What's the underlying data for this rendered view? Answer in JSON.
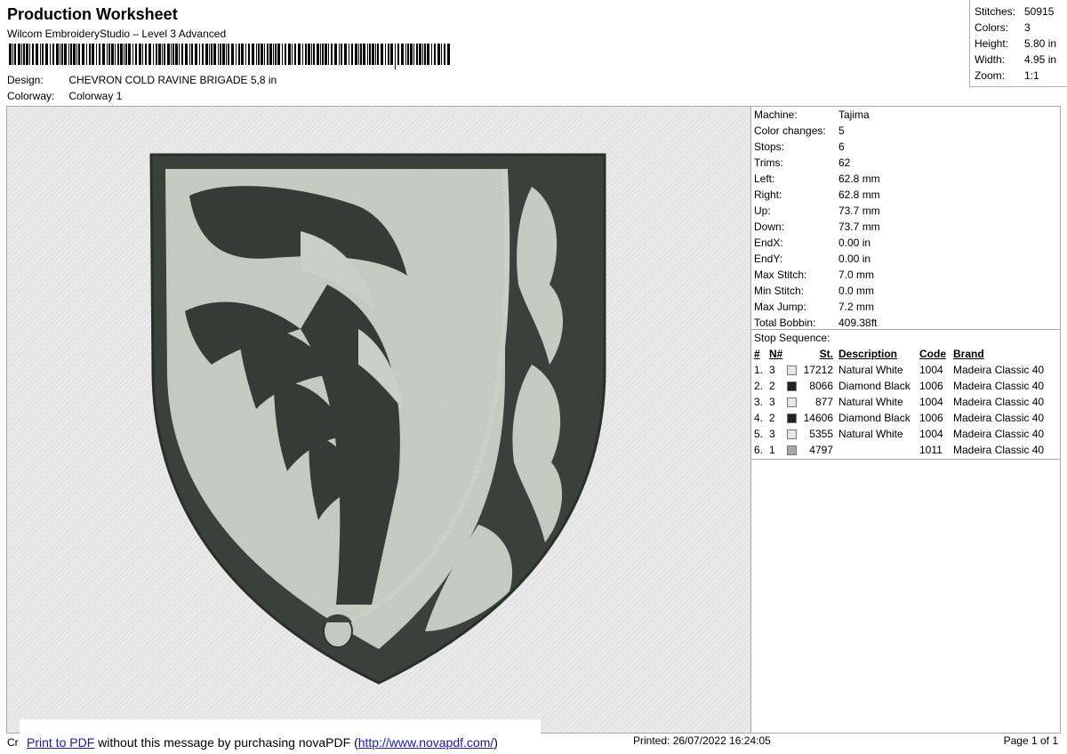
{
  "header": {
    "title": "Production Worksheet",
    "subtitle": "Wilcom EmbroideryStudio – Level 3 Advanced",
    "design_label": "Design:",
    "design_value": "CHEVRON COLD RAVINE BRIGADE 5,8 in",
    "colorway_label": "Colorway:",
    "colorway_value": "Colorway 1"
  },
  "summary": [
    {
      "label": "Stitches:",
      "value": "50915"
    },
    {
      "label": "Colors:",
      "value": "3"
    },
    {
      "label": "Height:",
      "value": "5.80 in"
    },
    {
      "label": "Width:",
      "value": "4.95 in"
    },
    {
      "label": "Zoom:",
      "value": "1:1"
    }
  ],
  "machine": [
    {
      "label": "Machine:",
      "value": "Tajima"
    },
    {
      "label": "Color changes:",
      "value": "5"
    },
    {
      "label": "Stops:",
      "value": "6"
    },
    {
      "label": "Trims:",
      "value": "62"
    },
    {
      "label": "Left:",
      "value": "62.8 mm"
    },
    {
      "label": "Right:",
      "value": "62.8 mm"
    },
    {
      "label": "Up:",
      "value": "73.7 mm"
    },
    {
      "label": "Down:",
      "value": "73.7 mm"
    },
    {
      "label": "EndX:",
      "value": "0.00 in"
    },
    {
      "label": "EndY:",
      "value": "0.00 in"
    },
    {
      "label": "Max Stitch:",
      "value": "7.0 mm"
    },
    {
      "label": "Min Stitch:",
      "value": "0.0 mm"
    },
    {
      "label": "Max Jump:",
      "value": "7.2 mm"
    },
    {
      "label": "Total Bobbin:",
      "value": "409.38ft"
    }
  ],
  "stop_sequence": {
    "caption": "Stop Sequence:",
    "headers": {
      "num": "#",
      "n": "N#",
      "st": "St.",
      "desc": "Description",
      "code": "Code",
      "brand": "Brand"
    },
    "rows": [
      {
        "num": "1.",
        "n": "3",
        "color": "#e6e8e6",
        "st": "17212",
        "desc": "Natural White",
        "code": "1004",
        "brand": "Madeira Classic 40"
      },
      {
        "num": "2.",
        "n": "2",
        "color": "#222222",
        "st": "8066",
        "desc": "Diamond Black",
        "code": "1006",
        "brand": "Madeira Classic 40"
      },
      {
        "num": "3.",
        "n": "3",
        "color": "#e6e8e6",
        "st": "877",
        "desc": "Natural White",
        "code": "1004",
        "brand": "Madeira Classic 40"
      },
      {
        "num": "4.",
        "n": "2",
        "color": "#222222",
        "st": "14606",
        "desc": "Diamond Black",
        "code": "1006",
        "brand": "Madeira Classic 40"
      },
      {
        "num": "5.",
        "n": "3",
        "color": "#e6e8e6",
        "st": "5355",
        "desc": "Natural White",
        "code": "1004",
        "brand": "Madeira Classic 40"
      },
      {
        "num": "6.",
        "n": "1",
        "color": "#a6aaa6",
        "st": "4797",
        "desc": "",
        "code": "1011",
        "brand": "Madeira Classic 40"
      }
    ]
  },
  "footer": {
    "cr": "Cr",
    "link_text": "Print to PDF",
    "mid_text": " without this message by purchasing novaPDF (",
    "url_text": "http://www.novapdf.com/",
    "end_text": ")",
    "printed": "Printed: 26/07/2022 16:24:05",
    "page": "Page 1 of 1"
  },
  "colors": {
    "dark_thread": "#373d37",
    "light_thread": "#c7cec4",
    "background": "#eaeaea"
  }
}
